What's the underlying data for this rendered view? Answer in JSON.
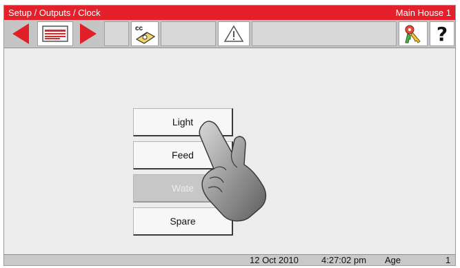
{
  "titlebar": {
    "breadcrumb": "Setup / Outputs / Clock",
    "house": "Main House 1"
  },
  "toolbar": {
    "buttons": [
      {
        "name": "back-arrow",
        "icon": "arrow-left-icon"
      },
      {
        "name": "menu-card",
        "icon": "card-icon"
      },
      {
        "name": "forward-arrow",
        "icon": "arrow-right-icon"
      },
      {
        "name": "cc-cursor",
        "icon": "cc-cursor-icon",
        "label": "cc"
      },
      {
        "name": "alarm",
        "icon": "warning-icon"
      },
      {
        "name": "keys",
        "icon": "keys-icon"
      },
      {
        "name": "help",
        "icon": "help-icon",
        "label": "?"
      }
    ]
  },
  "menu": {
    "items": [
      {
        "label": "Light",
        "enabled": true
      },
      {
        "label": "Feed",
        "enabled": true
      },
      {
        "label": "Wate",
        "enabled": false
      },
      {
        "label": "Spare",
        "enabled": true
      }
    ]
  },
  "status": {
    "date": "12 Oct 2010",
    "time": "4:27:02 pm",
    "age_label": "Age",
    "age_value": "1"
  },
  "colors": {
    "title_red": "#e5202b",
    "arrow_red": "#e01f26",
    "background": "#ececec"
  }
}
